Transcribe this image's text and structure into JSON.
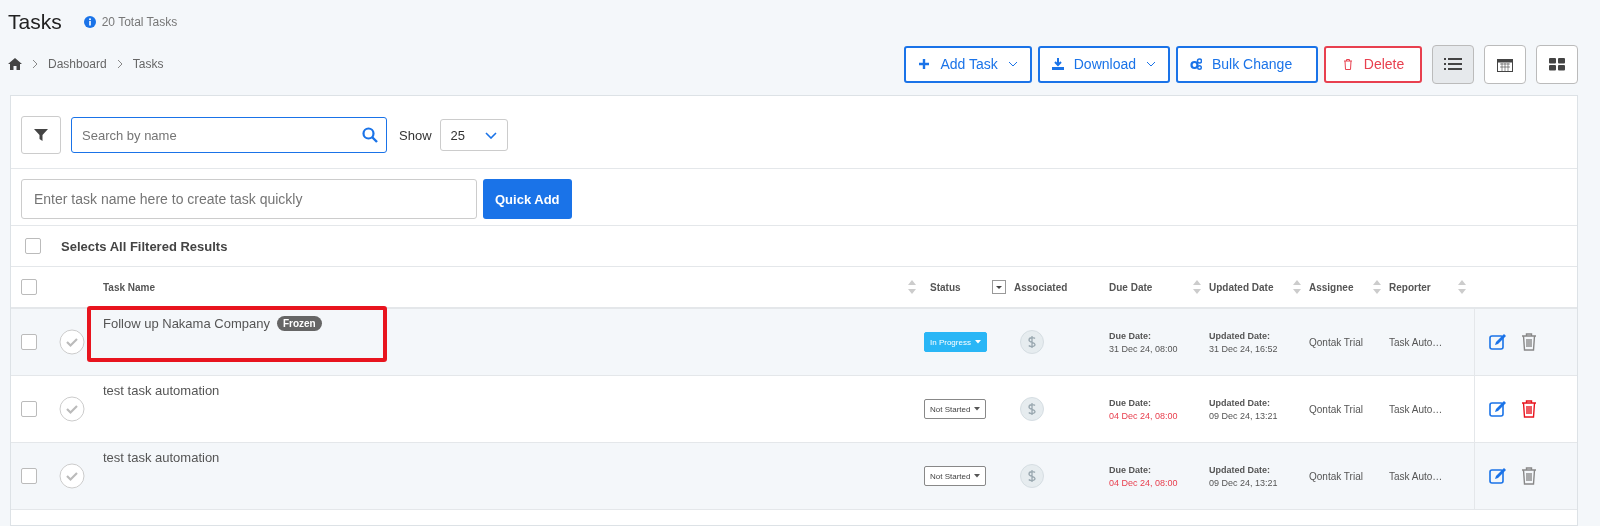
{
  "page": {
    "title": "Tasks",
    "total": "20 Total Tasks"
  },
  "breadcrumb": [
    "Dashboard",
    "Tasks"
  ],
  "actions": [
    {
      "label": "Add Task",
      "kind": "add",
      "dropdown": true
    },
    {
      "label": "Download",
      "kind": "download",
      "dropdown": true
    },
    {
      "label": "Bulk Change",
      "kind": "bulk",
      "dropdown": false
    },
    {
      "label": "Delete",
      "kind": "delete",
      "dropdown": false
    }
  ],
  "views": [
    {
      "kind": "list",
      "selected": true
    },
    {
      "kind": "calendar",
      "selected": false
    },
    {
      "kind": "board",
      "selected": false
    }
  ],
  "search": {
    "placeholder": "Search by name"
  },
  "show": {
    "label": "Show",
    "value": "25"
  },
  "quick_add": {
    "placeholder": "Enter task name here to create task quickly",
    "button": "Quick Add"
  },
  "select_all": {
    "label": "Selects All Filtered Results",
    "checked": false
  },
  "table": {
    "columns": [
      {
        "label": "Task Name",
        "sort": true
      },
      {
        "label": "Status",
        "sort": false,
        "filter": true
      },
      {
        "label": "Associated",
        "sort": false
      },
      {
        "label": "Due Date",
        "sort": true
      },
      {
        "label": "Updated Date",
        "sort": true
      },
      {
        "label": "Assignee",
        "sort": true
      },
      {
        "label": "Reporter",
        "sort": true
      }
    ],
    "header_checked": false,
    "rows": [
      {
        "checked": false,
        "name": "Follow up Nakama Company",
        "tag": "Frozen",
        "highlighted": true,
        "status": {
          "label": "In Progress",
          "kind": "filled"
        },
        "due_label": "Due Date:",
        "due": "31 Dec 24, 08:00",
        "overdue": false,
        "updated_label": "Updated Date:",
        "updated": "31 Dec 24, 16:52",
        "assignee": "Qontak Trial",
        "reporter": "Task Auto…",
        "delete_hover": false
      },
      {
        "checked": false,
        "name": "test task automation",
        "highlighted": false,
        "status": {
          "label": "Not Started",
          "kind": "outline"
        },
        "due_label": "Due Date:",
        "due": "04 Dec 24, 08:00",
        "overdue": true,
        "updated_label": "Updated Date:",
        "updated": "09 Dec 24, 13:21",
        "assignee": "Qontak Trial",
        "reporter": "Task Auto…",
        "delete_hover": true
      },
      {
        "checked": false,
        "name": "test task automation",
        "highlighted": false,
        "status": {
          "label": "Not Started",
          "kind": "outline"
        },
        "due_label": "Due Date:",
        "due": "04 Dec 24, 08:00",
        "overdue": true,
        "updated_label": "Updated Date:",
        "updated": "09 Dec 24, 13:21",
        "assignee": "Qontak Trial",
        "reporter": "Task Auto…",
        "delete_hover": false
      }
    ]
  }
}
